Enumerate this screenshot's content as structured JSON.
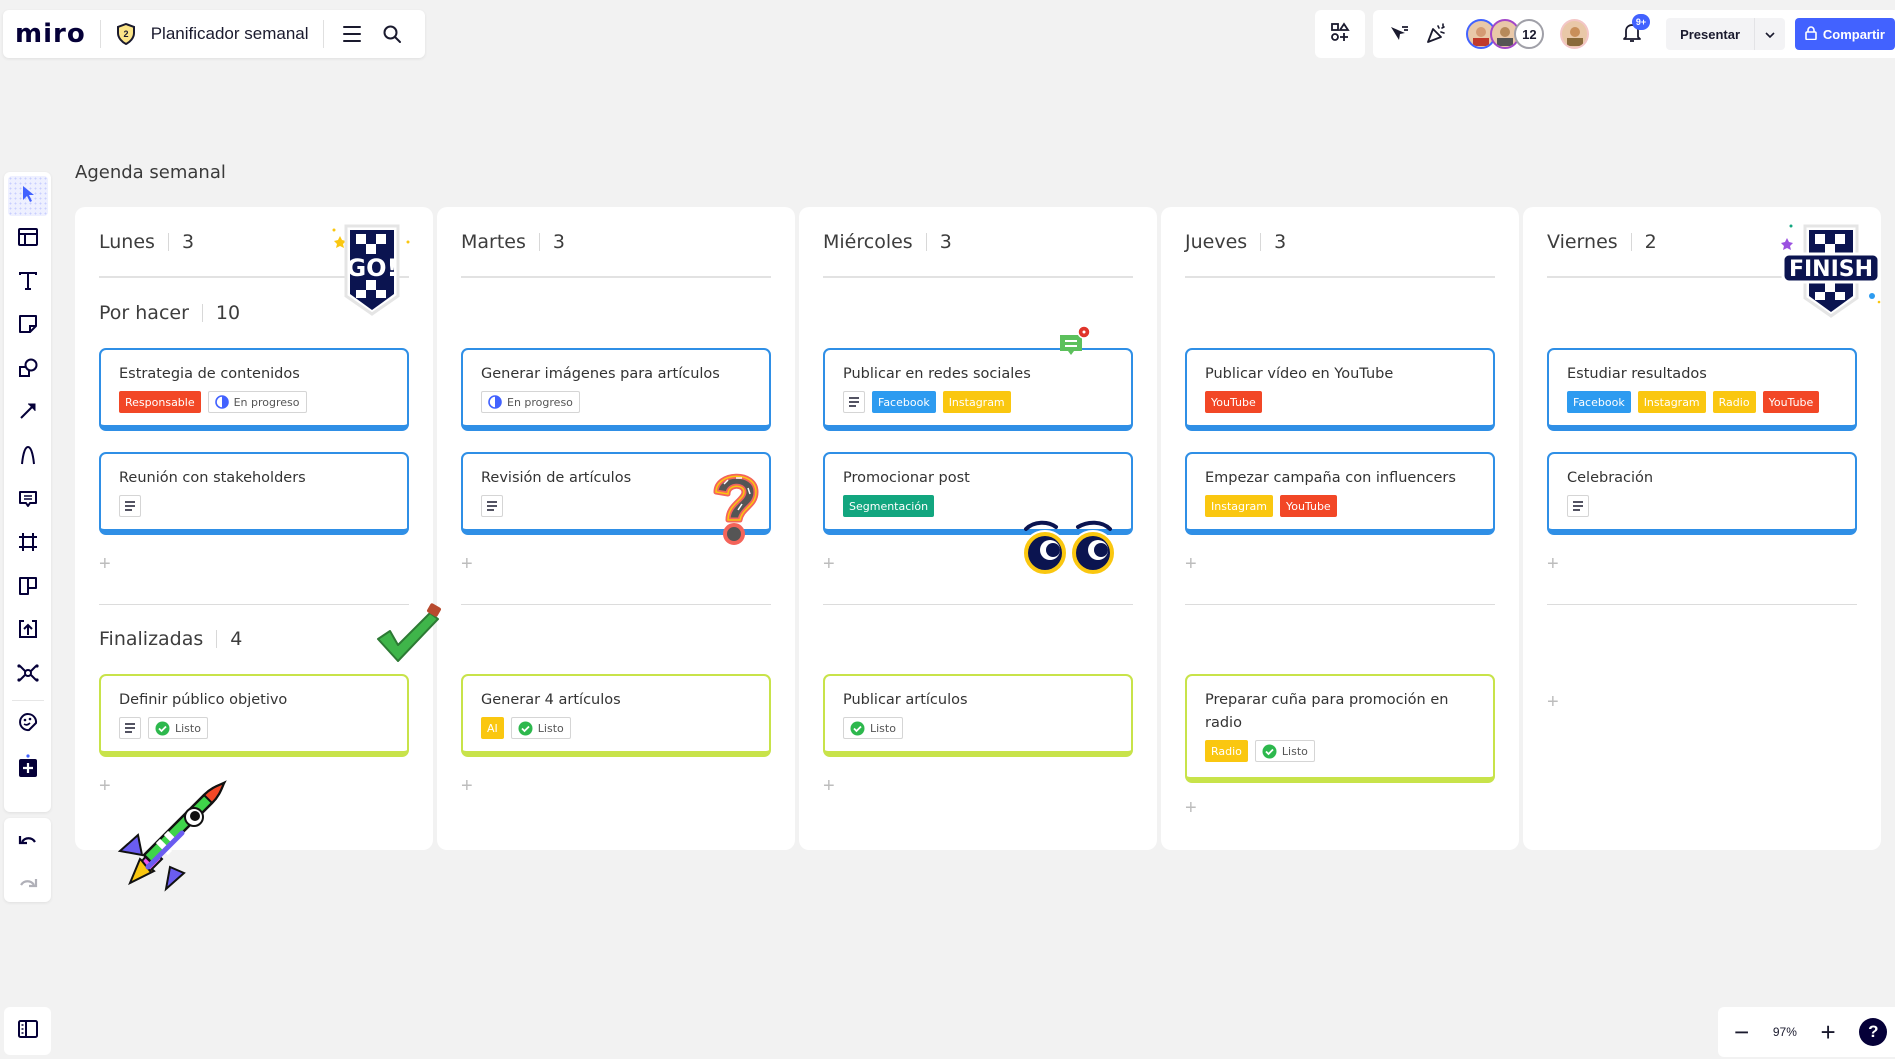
{
  "header": {
    "logo": "miro",
    "board_title": "Planificador semanal",
    "badge_level": "2",
    "avatar_count": "12",
    "notifications_badge": "9+",
    "present_label": "Presentar",
    "share_label": "Compartir"
  },
  "toolbar": {
    "tools": [
      {
        "name": "select",
        "icon": "cursor-icon",
        "active": true
      },
      {
        "name": "templates",
        "icon": "layout-icon"
      },
      {
        "name": "text",
        "icon": "text-icon"
      },
      {
        "name": "sticky-note",
        "icon": "sticky-note-icon"
      },
      {
        "name": "shapes",
        "icon": "shapes-icon"
      },
      {
        "name": "connection-line",
        "icon": "arrow-icon"
      },
      {
        "name": "pen",
        "icon": "pen-icon"
      },
      {
        "name": "comment",
        "icon": "comment-icon"
      },
      {
        "name": "frame",
        "icon": "frame-icon"
      },
      {
        "name": "cards",
        "icon": "cards-icon"
      },
      {
        "name": "upload",
        "icon": "upload-icon"
      },
      {
        "name": "mind-map",
        "icon": "mind-map-icon"
      },
      {
        "name": "stickers",
        "icon": "sticker-icon"
      },
      {
        "name": "more-apps",
        "icon": "plus-square-icon"
      }
    ]
  },
  "zoom": {
    "value": "97%",
    "minus": "−",
    "plus": "+",
    "help": "?"
  },
  "board": {
    "title": "Agenda semanal",
    "sections": {
      "todo": {
        "label": "Por hacer",
        "count": "10"
      },
      "done": {
        "label": "Finalizadas",
        "count": "4"
      }
    },
    "add_symbol": "+",
    "columns": [
      {
        "day": "Lunes",
        "count": "3",
        "todo": [
          {
            "title": "Estrategia de contenidos",
            "tags": [
              {
                "type": "label",
                "text": "Responsable",
                "color": "#f24726"
              },
              {
                "type": "status",
                "text": "En progreso",
                "icon": "half-circle-icon"
              }
            ]
          },
          {
            "title": "Reunión con stakeholders",
            "tags": [
              {
                "type": "description"
              }
            ]
          }
        ],
        "done": [
          {
            "title": "Definir público objetivo",
            "tags": [
              {
                "type": "description"
              },
              {
                "type": "status",
                "text": "Listo",
                "icon": "check-circle-icon"
              }
            ]
          }
        ]
      },
      {
        "day": "Martes",
        "count": "3",
        "todo": [
          {
            "title": "Generar imágenes para artículos",
            "tags": [
              {
                "type": "status",
                "text": "En progreso",
                "icon": "half-circle-icon"
              }
            ]
          },
          {
            "title": "Revisión de artículos",
            "tags": [
              {
                "type": "description"
              }
            ]
          }
        ],
        "done": [
          {
            "title": "Generar 4 artículos",
            "tags": [
              {
                "type": "label",
                "text": "AI",
                "color": "#fac710"
              },
              {
                "type": "status",
                "text": "Listo",
                "icon": "check-circle-icon"
              }
            ]
          }
        ]
      },
      {
        "day": "Miércoles",
        "count": "3",
        "todo": [
          {
            "title": "Publicar en redes sociales",
            "tags": [
              {
                "type": "description"
              },
              {
                "type": "label",
                "text": "Facebook",
                "color": "#2d9bf0"
              },
              {
                "type": "label",
                "text": "Instagram",
                "color": "#fac710"
              }
            ]
          },
          {
            "title": "Promocionar post",
            "tags": [
              {
                "type": "label",
                "text": "Segmentación",
                "color": "#12a67f"
              }
            ]
          }
        ],
        "done": [
          {
            "title": "Publicar artículos",
            "tags": [
              {
                "type": "status",
                "text": "Listo",
                "icon": "check-circle-icon"
              }
            ]
          }
        ]
      },
      {
        "day": "Jueves",
        "count": "3",
        "todo": [
          {
            "title": "Publicar vídeo en YouTube",
            "tags": [
              {
                "type": "label",
                "text": "YouTube",
                "color": "#f24726"
              }
            ]
          },
          {
            "title": "Empezar campaña con influencers",
            "tags": [
              {
                "type": "label",
                "text": "Instagram",
                "color": "#fac710"
              },
              {
                "type": "label",
                "text": "YouTube",
                "color": "#f24726"
              }
            ]
          }
        ],
        "done": [
          {
            "title": "Preparar cuña para promoción en radio",
            "tags": [
              {
                "type": "label",
                "text": "Radio",
                "color": "#fac710"
              },
              {
                "type": "status",
                "text": "Listo",
                "icon": "check-circle-icon"
              }
            ]
          }
        ]
      },
      {
        "day": "Viernes",
        "count": "2",
        "todo": [
          {
            "title": "Estudiar resultados",
            "tags": [
              {
                "type": "label",
                "text": "Facebook",
                "color": "#2d9bf0"
              },
              {
                "type": "label",
                "text": "Instagram",
                "color": "#fac710"
              },
              {
                "type": "label",
                "text": "Radio",
                "color": "#fac710"
              },
              {
                "type": "label",
                "text": "YouTube",
                "color": "#f24726"
              }
            ]
          },
          {
            "title": "Celebración",
            "tags": [
              {
                "type": "description"
              }
            ]
          }
        ],
        "done": []
      }
    ]
  },
  "stickers": [
    "go-sticker",
    "finish-sticker",
    "question-mark-sticker",
    "eyes-sticker",
    "checkmark-sticker",
    "rocket-sticker",
    "comment-notification"
  ],
  "colors": {
    "accent": "#4262ff",
    "todo_border": "#2f8fe6",
    "done_border": "#c8e34a",
    "status_done": "#2db84d",
    "status_progress": "#4262ff"
  }
}
